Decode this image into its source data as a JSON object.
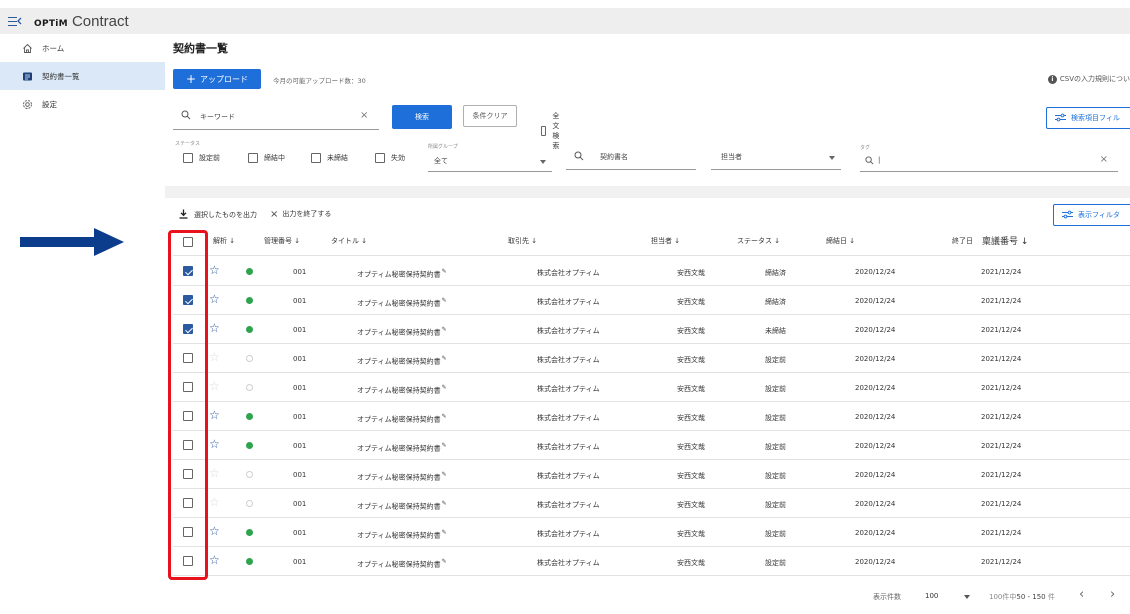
{
  "app": {
    "brand": "OPTiM",
    "product": "Contract"
  },
  "colors": {
    "accent": "#1e6fd9",
    "star": "#1e4f9b",
    "status_dot": "#2ea44f",
    "annotation_red": "#e8121d",
    "annotation_arrow": "#0b3d8c",
    "sidebar_active": "#dbe8f7"
  },
  "sidebar": {
    "items": [
      {
        "label": "ホーム",
        "icon": "home-icon"
      },
      {
        "label": "契約書一覧",
        "icon": "document-list-icon"
      },
      {
        "label": "設定",
        "icon": "gear-icon"
      }
    ]
  },
  "page": {
    "title": "契約書一覧",
    "upload_label": "アップロード",
    "upload_count": "今月の可能アップロード数：30",
    "csv_rule": "CSVの入力規則につい"
  },
  "search": {
    "keyword_placeholder": "キーワード",
    "search_label": "検索",
    "clear_label": "条件クリア",
    "fulltext_label": "全文検索",
    "filter_button": "検索項目フィル",
    "status_label": "ステータス",
    "statuses": [
      "設定前",
      "締結中",
      "未締結",
      "失効"
    ],
    "group_label": "所属グループ",
    "group_value": "全て",
    "name_placeholder": "契約書名",
    "person_placeholder": "担当者",
    "tag_label": "タグ",
    "tag_placeholder": "|"
  },
  "toolbar": {
    "export_selected": "選択したものを出力",
    "end_export": "出力を終了する",
    "display_filter": "表示フィルタ"
  },
  "table": {
    "headers": {
      "analysis": "解析 ↓",
      "management_no": "管理番号 ↓",
      "title": "タイトル ↓",
      "partner": "取引先 ↓",
      "person": "担当者 ↓",
      "status": "ステータス ↓",
      "signed": "締結日 ↓",
      "end": "終了日",
      "approval_no": "稟議番号 ↓"
    },
    "rows": [
      {
        "checked": true,
        "starred": true,
        "active": true,
        "id": "001",
        "title": "オプティム秘密保持契約書",
        "partner": "株式会社オプティム",
        "person": "安西文哉",
        "status": "締結済",
        "signed": "2020/12/24",
        "end": "2021/12/24"
      },
      {
        "checked": true,
        "starred": true,
        "active": true,
        "id": "001",
        "title": "オプティム秘密保持契約書",
        "partner": "株式会社オプティム",
        "person": "安西文哉",
        "status": "締結済",
        "signed": "2020/12/24",
        "end": "2021/12/24"
      },
      {
        "checked": true,
        "starred": true,
        "active": true,
        "id": "001",
        "title": "オプティム秘密保持契約書",
        "partner": "株式会社オプティム",
        "person": "安西文哉",
        "status": "未締結",
        "signed": "2020/12/24",
        "end": "2021/12/24"
      },
      {
        "checked": false,
        "starred": false,
        "active": false,
        "id": "001",
        "title": "オプティム秘密保持契約書",
        "partner": "株式会社オプティム",
        "person": "安西文哉",
        "status": "設定前",
        "signed": "2020/12/24",
        "end": "2021/12/24"
      },
      {
        "checked": false,
        "starred": false,
        "active": false,
        "id": "001",
        "title": "オプティム秘密保持契約書",
        "partner": "株式会社オプティム",
        "person": "安西文哉",
        "status": "設定前",
        "signed": "2020/12/24",
        "end": "2021/12/24"
      },
      {
        "checked": false,
        "starred": true,
        "active": true,
        "id": "001",
        "title": "オプティム秘密保持契約書",
        "partner": "株式会社オプティム",
        "person": "安西文哉",
        "status": "設定前",
        "signed": "2020/12/24",
        "end": "2021/12/24"
      },
      {
        "checked": false,
        "starred": true,
        "active": true,
        "id": "001",
        "title": "オプティム秘密保持契約書",
        "partner": "株式会社オプティム",
        "person": "安西文哉",
        "status": "設定前",
        "signed": "2020/12/24",
        "end": "2021/12/24"
      },
      {
        "checked": false,
        "starred": false,
        "active": false,
        "id": "001",
        "title": "オプティム秘密保持契約書",
        "partner": "株式会社オプティム",
        "person": "安西文哉",
        "status": "設定前",
        "signed": "2020/12/24",
        "end": "2021/12/24"
      },
      {
        "checked": false,
        "starred": false,
        "active": false,
        "id": "001",
        "title": "オプティム秘密保持契約書",
        "partner": "株式会社オプティム",
        "person": "安西文哉",
        "status": "設定前",
        "signed": "2020/12/24",
        "end": "2021/12/24"
      },
      {
        "checked": false,
        "starred": true,
        "active": true,
        "id": "001",
        "title": "オプティム秘密保持契約書",
        "partner": "株式会社オプティム",
        "person": "安西文哉",
        "status": "設定前",
        "signed": "2020/12/24",
        "end": "2021/12/24"
      },
      {
        "checked": false,
        "starred": true,
        "active": true,
        "id": "001",
        "title": "オプティム秘密保持契約書",
        "partner": "株式会社オプティム",
        "person": "安西文哉",
        "status": "設定前",
        "signed": "2020/12/24",
        "end": "2021/12/24"
      }
    ]
  },
  "pagination": {
    "label": "表示件数",
    "page_size": "100",
    "total_prefix": "100件中",
    "range": "50 - 150",
    "unit": "件",
    "prev": "‹",
    "next": "›"
  }
}
